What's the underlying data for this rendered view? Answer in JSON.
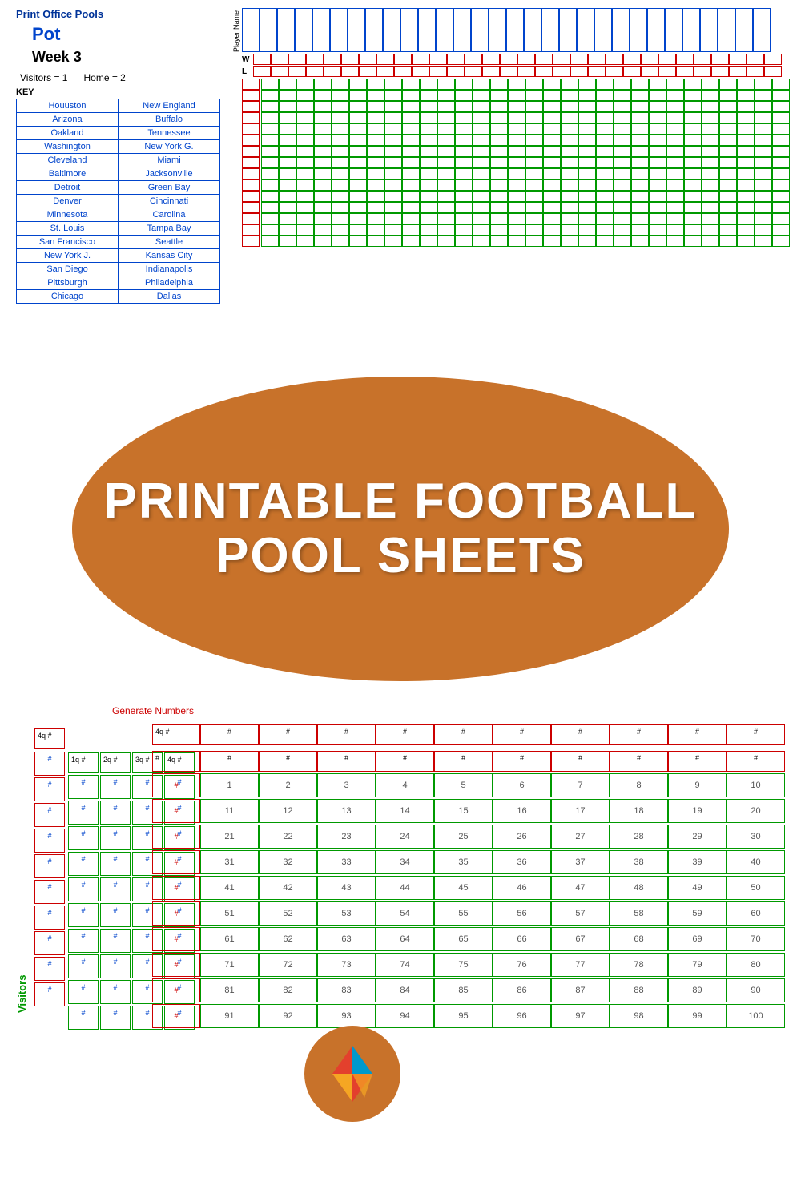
{
  "header": {
    "print_link": "Print Office Pools",
    "pot_label": "Pot",
    "week_label": "Week 3",
    "visitors_label": "Visitors = 1",
    "home_label": "Home = 2",
    "key_label": "KEY"
  },
  "games": [
    {
      "visitor": "Houuston",
      "home": "New England"
    },
    {
      "visitor": "Arizona",
      "home": "Buffalo"
    },
    {
      "visitor": "Oakland",
      "home": "Tennessee"
    },
    {
      "visitor": "Washington",
      "home": "New York G."
    },
    {
      "visitor": "Cleveland",
      "home": "Miami"
    },
    {
      "visitor": "Baltimore",
      "home": "Jacksonville"
    },
    {
      "visitor": "Detroit",
      "home": "Green Bay"
    },
    {
      "visitor": "Denver",
      "home": "Cincinnati"
    },
    {
      "visitor": "Minnesota",
      "home": "Carolina"
    },
    {
      "visitor": "St. Louis",
      "home": "Tampa Bay"
    },
    {
      "visitor": "San Francisco",
      "home": "Seattle"
    },
    {
      "visitor": "New York J.",
      "home": "Kansas City"
    },
    {
      "visitor": "San Diego",
      "home": "Indianapolis"
    },
    {
      "visitor": "Pittsburgh",
      "home": "Philadelphia"
    },
    {
      "visitor": "Chicago",
      "home": "Dallas"
    }
  ],
  "pool": {
    "generate_label": "Generate Numbers",
    "visitors_label": "Visitors",
    "quarters": [
      "1q #",
      "2q #",
      "3q #",
      "4q #"
    ],
    "score_placeholder": "#",
    "top_row_label": "4q #",
    "home_numbers": [
      "#",
      "#",
      "#",
      "#",
      "#",
      "#",
      "#",
      "#",
      "#",
      "#"
    ],
    "number_grid": [
      [
        1,
        2,
        3,
        4,
        5,
        6,
        7,
        8,
        9,
        10
      ],
      [
        11,
        12,
        13,
        14,
        15,
        16,
        17,
        18,
        19,
        20
      ],
      [
        21,
        22,
        23,
        24,
        25,
        26,
        27,
        28,
        29,
        30
      ],
      [
        31,
        32,
        33,
        34,
        35,
        36,
        37,
        38,
        39,
        40
      ],
      [
        41,
        42,
        43,
        44,
        45,
        46,
        47,
        48,
        49,
        50
      ],
      [
        51,
        52,
        53,
        54,
        55,
        56,
        57,
        58,
        59,
        60
      ],
      [
        61,
        62,
        63,
        64,
        65,
        66,
        67,
        68,
        69,
        70
      ],
      [
        71,
        72,
        73,
        74,
        75,
        76,
        77,
        78,
        79,
        80
      ],
      [
        81,
        82,
        83,
        84,
        85,
        86,
        87,
        88,
        89,
        90
      ],
      [
        91,
        92,
        93,
        94,
        95,
        96,
        97,
        98,
        99,
        100
      ]
    ]
  },
  "oval": {
    "line1": "Printable Football",
    "line2": "Pool Sheets"
  }
}
